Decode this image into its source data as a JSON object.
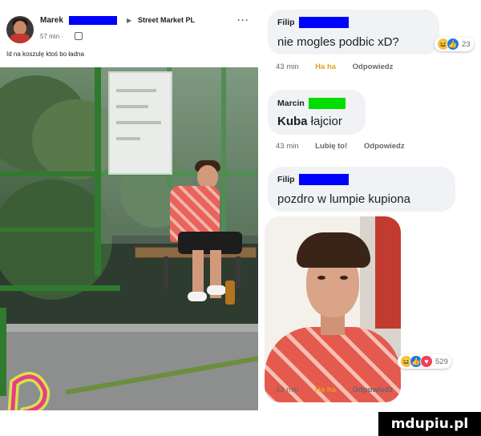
{
  "post": {
    "author": "Marek",
    "page": "Street Market PL",
    "more": "···",
    "time": "57 min ·",
    "caption": "Id na koszulę ktoś bo ładna"
  },
  "comments": [
    {
      "name": "Filip",
      "text": "nie mogles podbic xD?",
      "count": "23",
      "time": "43 min",
      "action1": "Ha ha",
      "action2": "Odpowiedz"
    },
    {
      "name": "Marcin",
      "text_bold": "Kuba",
      "text": "łajcior",
      "time": "43 min",
      "action1": "Lubię to!",
      "action2": "Odpowiedz"
    },
    {
      "name": "Filip",
      "text": "pozdro w lumpie kupiona",
      "count": "529",
      "time": "42 min",
      "action1": "Ha ha",
      "action2": "Odpowiedz"
    }
  ],
  "colors": {
    "redaction": "#0000ff",
    "redaction_green": "#00dd00",
    "comment_bg": "#f0f2f5",
    "meta": "#65676b"
  },
  "watermark": "mdupiu.pl",
  "icons": [
    "globe-icon",
    "more-options-icon",
    "haha-reaction-icon",
    "like-reaction-icon",
    "love-reaction-icon",
    "logo-p-icon"
  ]
}
